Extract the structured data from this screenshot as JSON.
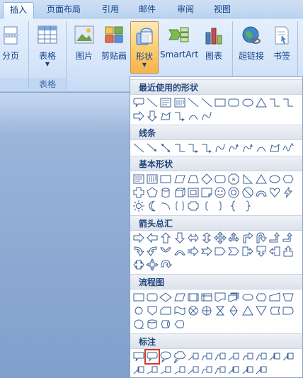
{
  "tabs": {
    "insert": "插入",
    "page_layout": "页面布局",
    "references": "引用",
    "mailings": "邮件",
    "review": "审阅",
    "view": "视图"
  },
  "ribbon": {
    "page_break_label": "分页",
    "table_label": "表格",
    "table_group_label": "表格",
    "picture_label": "图片",
    "clipart_label": "剪贴画",
    "shapes_label": "形状",
    "smartart_label": "SmartArt",
    "chart_label": "图表",
    "hyperlink_label": "超链接",
    "bookmark_label": "书签"
  },
  "gallery": {
    "sections": {
      "recent": "最近使用的形状",
      "lines": "线条",
      "basic": "基本形状",
      "arrows": "箭头总汇",
      "flowchart": "流程图",
      "callouts": "标注"
    },
    "selected_shape": "callout-rounded-rectangle"
  },
  "colors": {
    "accent": "#15428b",
    "selection": "#d33a2c",
    "pressed": "#fbcf72"
  }
}
